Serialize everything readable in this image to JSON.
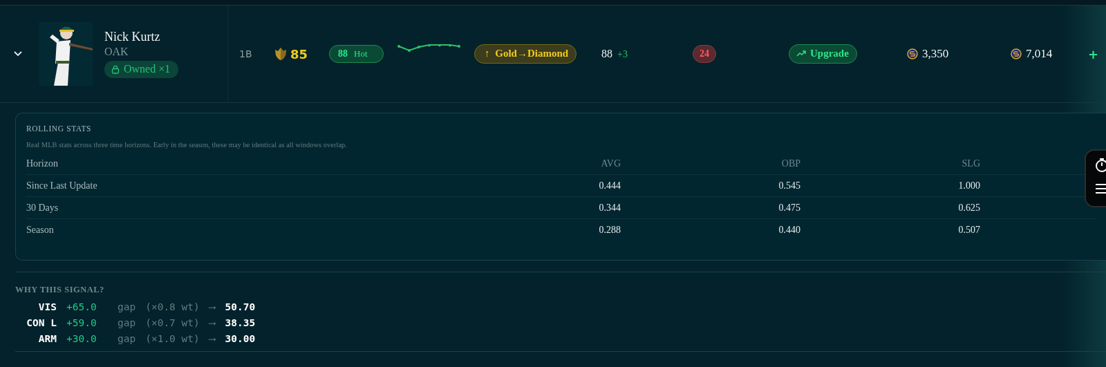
{
  "player": {
    "name": "Nick Kurtz",
    "team": "OAK",
    "owned": "Owned ×1",
    "expanded": true
  },
  "row": {
    "position": "1B",
    "rating": "85",
    "signal": {
      "score": "88",
      "label": "Hot"
    },
    "tier": {
      "arrow": "↑",
      "text": "Gold→Diamond"
    },
    "ovr": {
      "value": "88",
      "delta": "+3"
    },
    "count": "24",
    "action": "Upgrade",
    "price_1": "3,350",
    "price_2": "7,014",
    "add": "+"
  },
  "rolling_stats": {
    "title": "ROLLING STATS",
    "description": "Real MLB stats across three time horizons. Early in the season, these may be identical as all windows overlap.",
    "columns": [
      "Horizon",
      "AVG",
      "OBP",
      "SLG"
    ],
    "rows": [
      {
        "horizon": "Since Last Update",
        "values": [
          "0.444",
          "0.545",
          "1.000"
        ]
      },
      {
        "horizon": "30 Days",
        "values": [
          "0.344",
          "0.475",
          "0.625"
        ]
      },
      {
        "horizon": "Season",
        "values": [
          "0.288",
          "0.440",
          "0.507"
        ]
      }
    ]
  },
  "why": {
    "title": "WHY THIS SIGNAL?",
    "lines": [
      {
        "attr": "VIS",
        "gap": "+65.0",
        "word": "gap",
        "weight": "(×0.8 wt)",
        "arrow": "⟶",
        "result": "50.70"
      },
      {
        "attr": "CON L",
        "gap": "+59.0",
        "word": "gap",
        "weight": "(×0.7 wt)",
        "arrow": "⟶",
        "result": "38.35"
      },
      {
        "attr": "ARM",
        "gap": "+30.0",
        "word": "gap",
        "weight": "(×1.0 wt)",
        "arrow": "⟶",
        "result": "30.00"
      }
    ]
  }
}
